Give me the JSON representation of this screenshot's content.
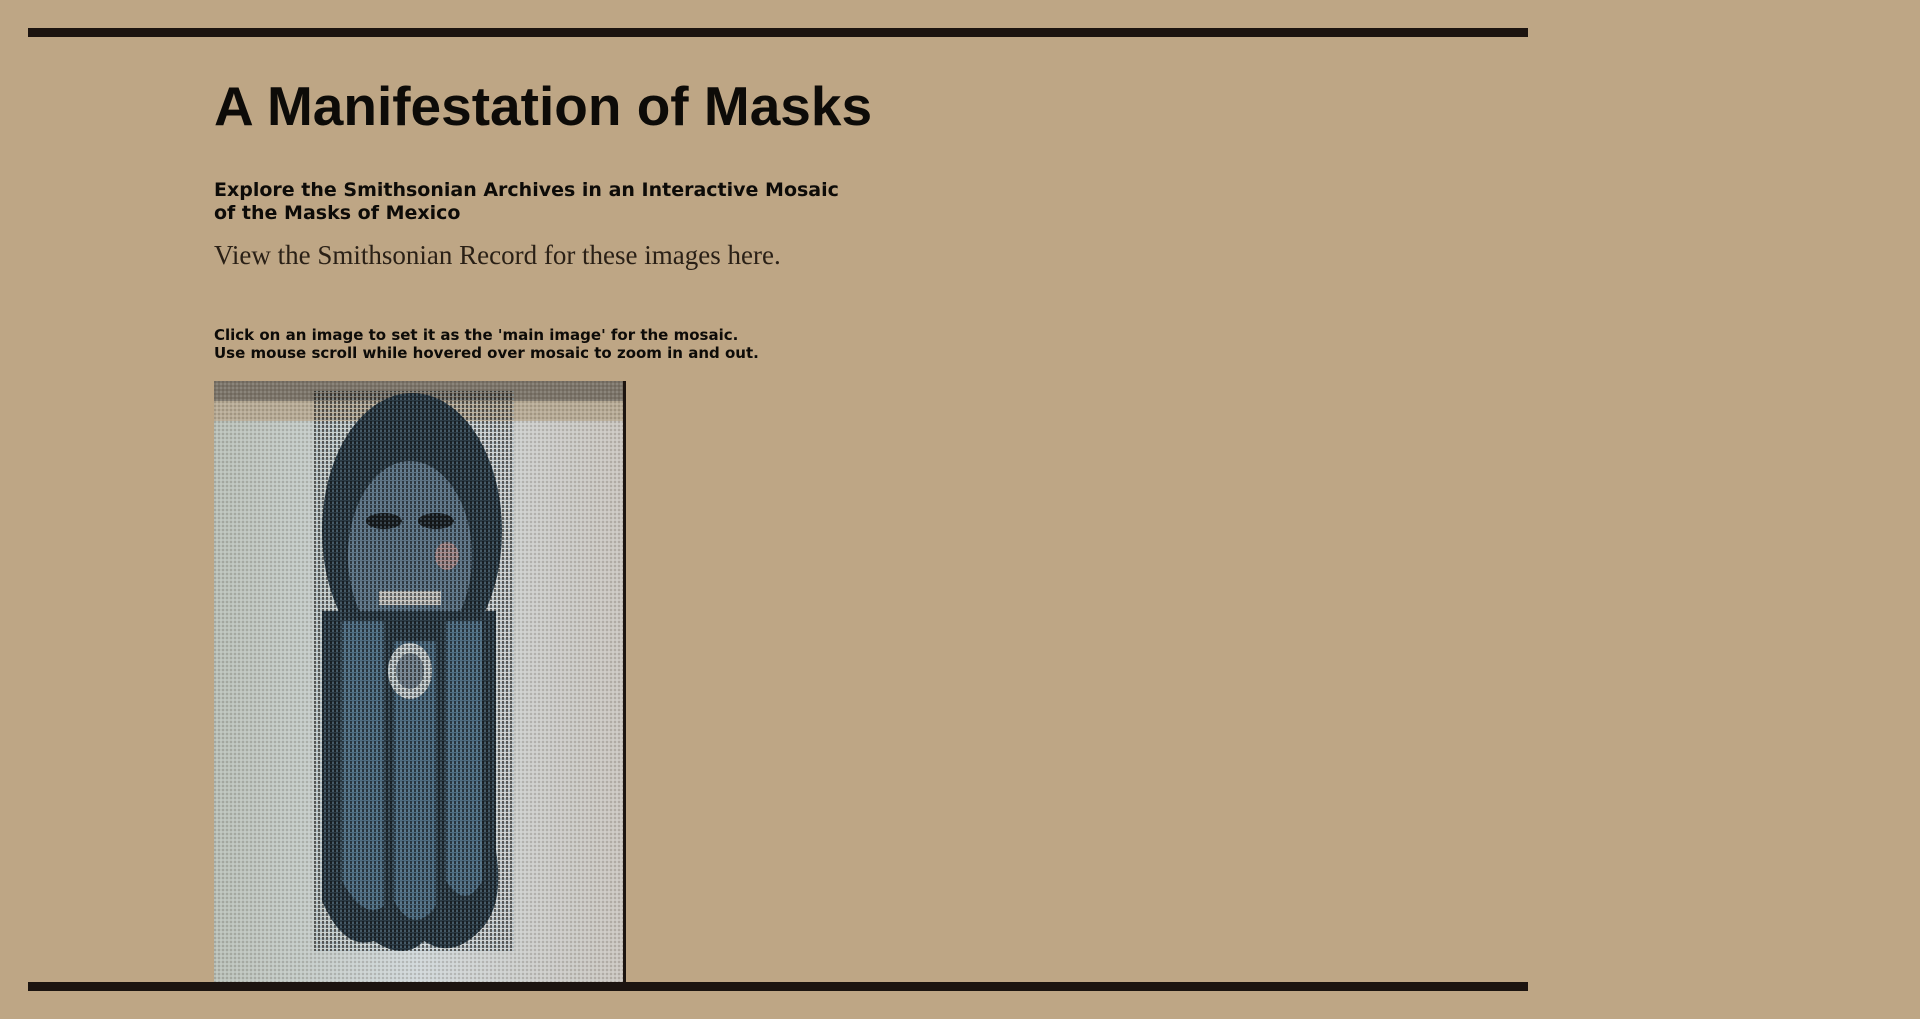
{
  "page": {
    "title": "A Manifestation of Masks",
    "subtitle": "Explore the Smithsonian Archives in an Interactive Mosaic of the Masks of Mexico",
    "record_link": "View the Smithsonian Record for these images here.",
    "instructions": [
      "Click on an image to set it as the 'main image' for the mosaic.",
      "Use mouse scroll while hovered over mosaic to zoom in and out."
    ]
  },
  "colors": {
    "background": "#bea685",
    "rule": "#1c1410",
    "mosaic_bg": "#c9cfcf",
    "mask_dark": "#2b3a44",
    "mask_blue": "#4d6b80"
  },
  "mosaic": {
    "subject": "carved mask with long braided beard"
  }
}
